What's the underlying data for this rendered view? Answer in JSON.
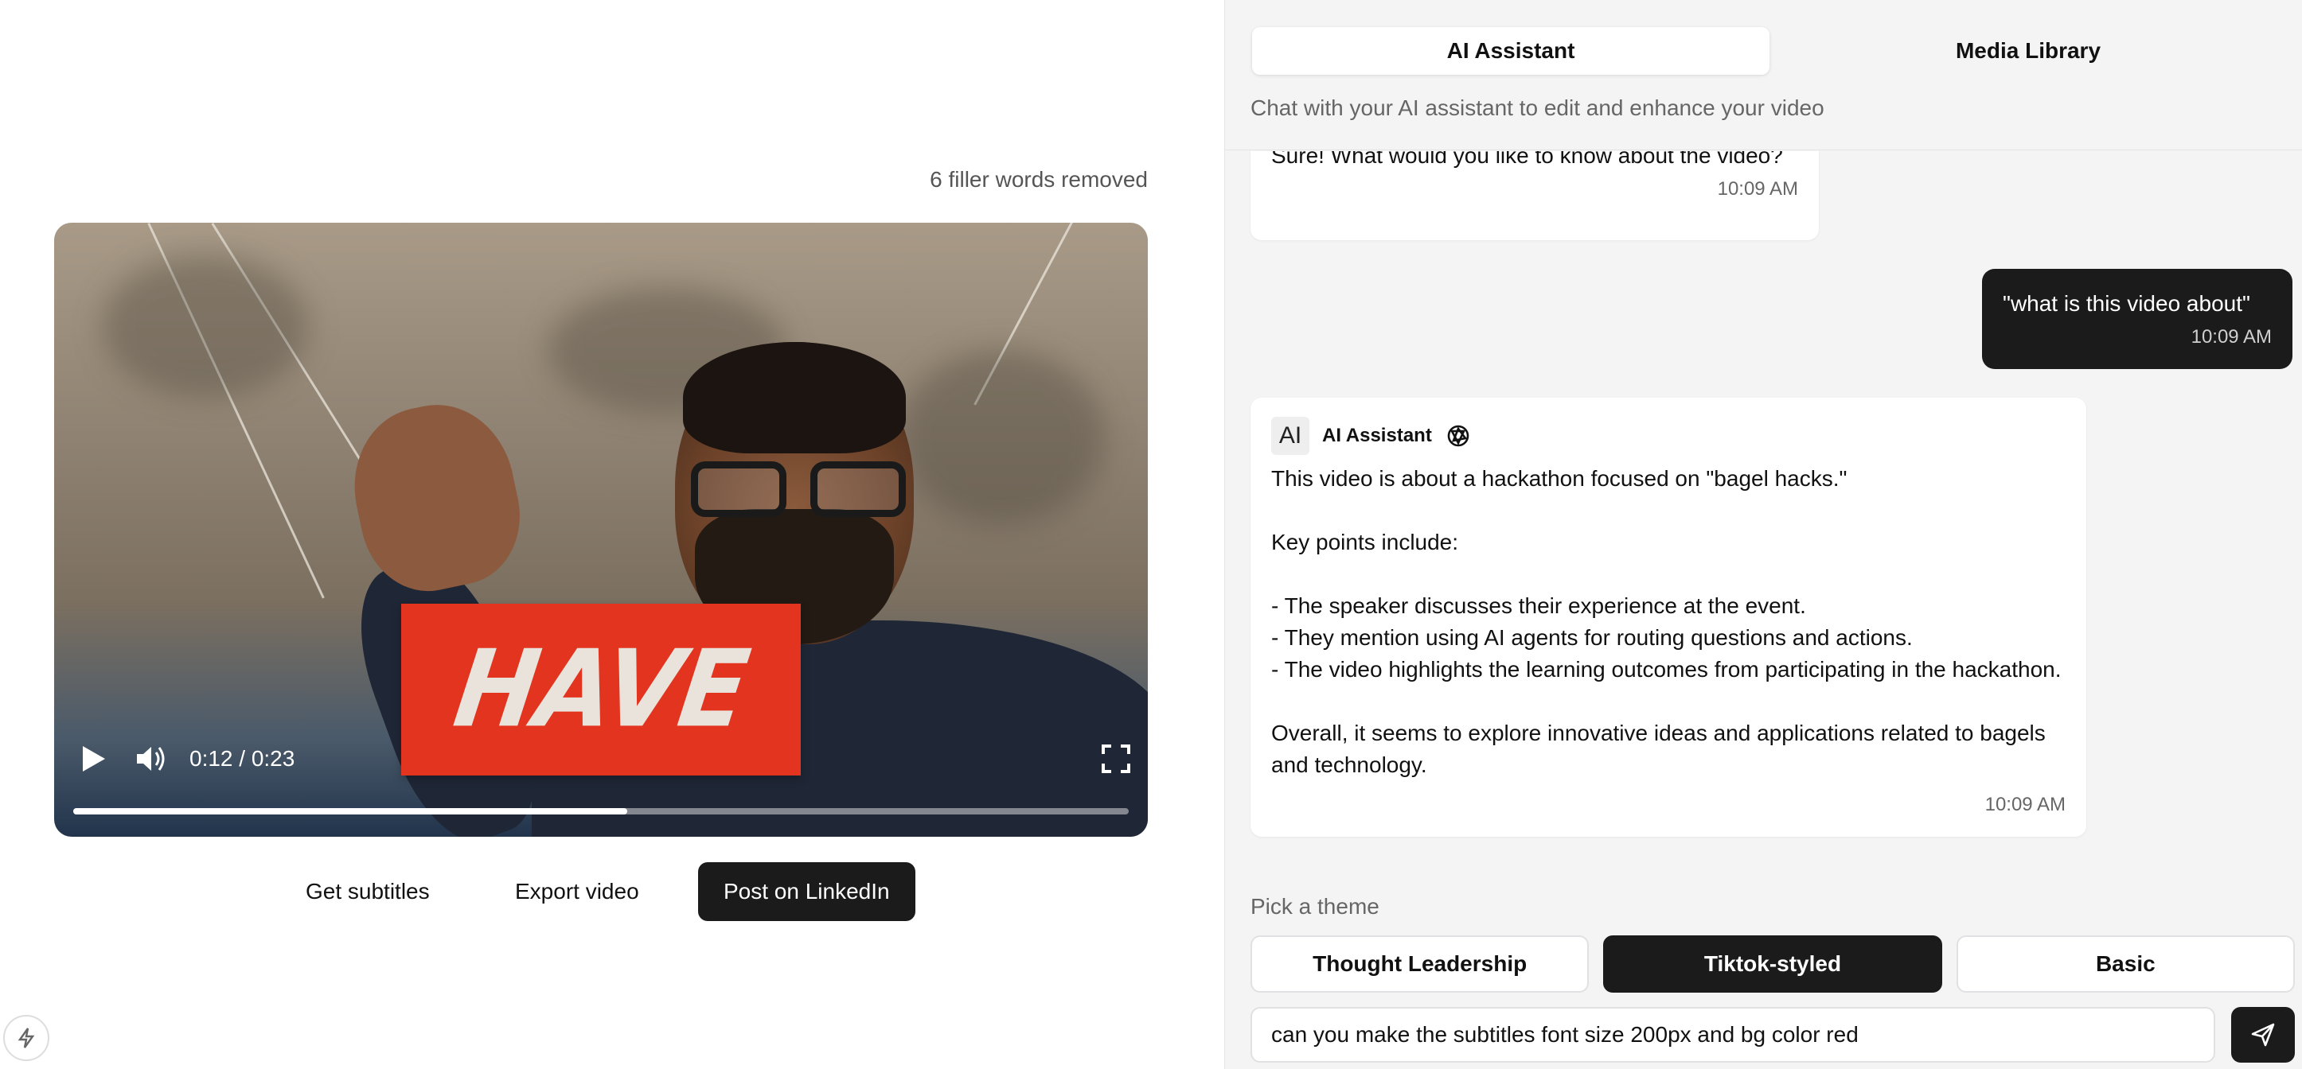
{
  "editor": {
    "filler_status": "6 filler words removed",
    "player": {
      "caption_word": "HAVE",
      "time_display": "0:12 / 0:23",
      "progress": 0.525
    },
    "actions": {
      "subtitles_label": "Get subtitles",
      "export_label": "Export video",
      "post_label": "Post on LinkedIn"
    }
  },
  "panel": {
    "tabs": [
      {
        "label": "AI Assistant",
        "active": true
      },
      {
        "label": "Media Library",
        "active": false
      }
    ],
    "subtitle": "Chat with your AI assistant to edit and enhance your video",
    "messages": [
      {
        "role": "assistant",
        "text": "Sure! What would you like to know about the video?",
        "time": "10:09 AM"
      },
      {
        "role": "user",
        "text": "\"what is this video about\"",
        "time": "10:09 AM"
      },
      {
        "role": "assistant",
        "avatar": "AI",
        "name": "AI Assistant",
        "text": "This video is about a hackathon focused on \"bagel hacks.\"\n\nKey points include:\n\n- The speaker discusses their experience at the event.\n- They mention using AI agents for routing questions and actions.\n- The video highlights the learning outcomes from participating in the hackathon.\n\nOverall, it seems to explore innovative ideas and applications related to bagels and technology.",
        "time": "10:09 AM"
      }
    ],
    "theme_label": "Pick a theme",
    "themes": [
      {
        "label": "Thought Leadership",
        "active": false
      },
      {
        "label": "Tiktok-styled",
        "active": true
      },
      {
        "label": "Basic",
        "active": false
      }
    ],
    "input_value": "can you make the subtitles font size 200px and bg color red"
  },
  "icons": {
    "play": "play-icon",
    "volume": "volume-icon",
    "fullscreen": "fullscreen-icon",
    "send": "send-icon",
    "openai": "openai-icon",
    "bolt": "bolt-icon"
  }
}
